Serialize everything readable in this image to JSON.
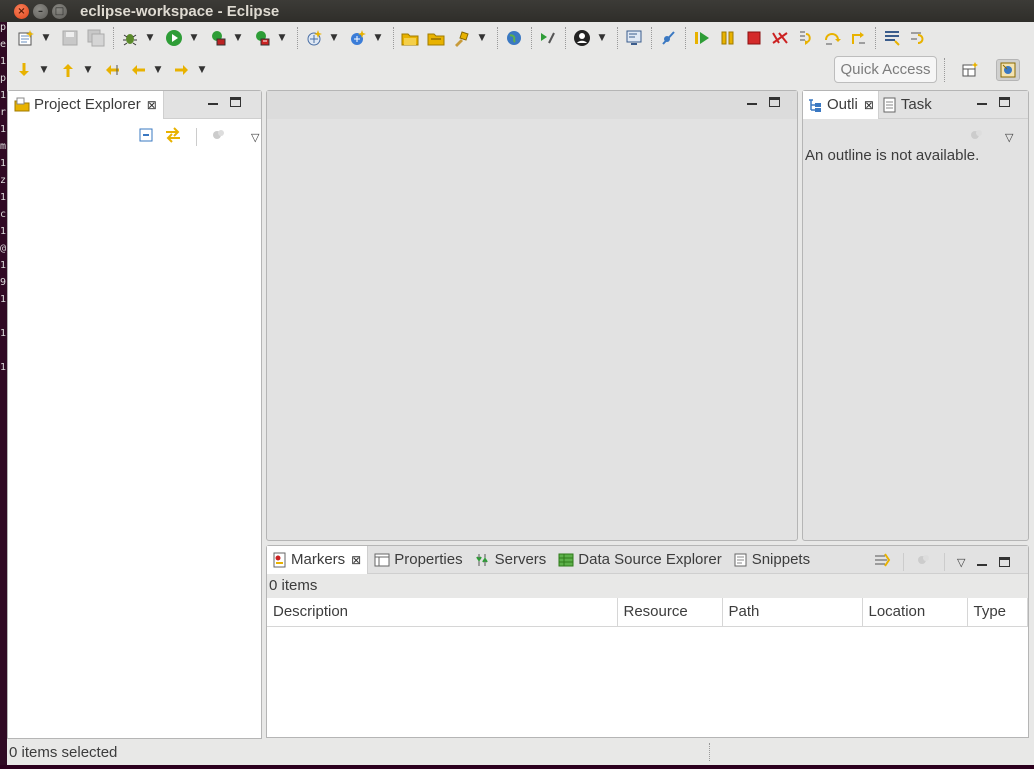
{
  "window": {
    "title": "eclipse-workspace - Eclipse"
  },
  "terminal_strip": {
    "chars": [
      "p",
      "e",
      "1",
      "p",
      "1",
      "r",
      "1",
      "m",
      "1",
      "z",
      "1",
      "c",
      "1",
      "@",
      "1",
      "9",
      "1",
      "",
      "1",
      "",
      "1"
    ]
  },
  "toolbar": {
    "quick_access_label": "Quick Access",
    "row1_icons": [
      "new-wizard-icon",
      "save-icon",
      "save-all-icon",
      "debug-icon",
      "run-icon",
      "coverage-icon",
      "external-tools-icon",
      "new-server-icon",
      "new-web-service-icon",
      "open-type-icon",
      "open-task-icon",
      "open-resource-icon",
      "browser-icon",
      "run-to-line-icon",
      "profile-icon",
      "console-icon",
      "skip-breakpoints-icon",
      "resume-icon",
      "suspend-icon",
      "terminate-icon",
      "disconnect-icon",
      "step-into-icon",
      "step-over-icon",
      "step-return-icon",
      "toggle-mark-occurrences-icon",
      "drop-to-frame-icon"
    ],
    "row2_icons": [
      "next-annotation-icon",
      "previous-annotation-icon",
      "last-edit-location-icon",
      "back-icon",
      "forward-icon"
    ]
  },
  "project_explorer": {
    "tab_label": "Project Explorer",
    "status": "0 items selected"
  },
  "outline": {
    "tab_label": "Outli",
    "second_tab_label": "Task",
    "message": "An outline is not available."
  },
  "bottom_panel": {
    "tabs": [
      {
        "label": "Markers",
        "icon": "markers-icon"
      },
      {
        "label": "Properties",
        "icon": "properties-icon"
      },
      {
        "label": "Servers",
        "icon": "servers-icon"
      },
      {
        "label": "Data Source Explorer",
        "icon": "data-source-icon"
      },
      {
        "label": "Snippets",
        "icon": "snippets-icon"
      }
    ],
    "items_count": "0 items",
    "columns": [
      "Description",
      "Resource",
      "Path",
      "Location",
      "Type"
    ]
  },
  "colors": {
    "window_bg": "#e8e8e7",
    "titlebar_bg": "#3c3b37",
    "close_button": "#e0451a",
    "desktop_bg": "#2c001e"
  }
}
